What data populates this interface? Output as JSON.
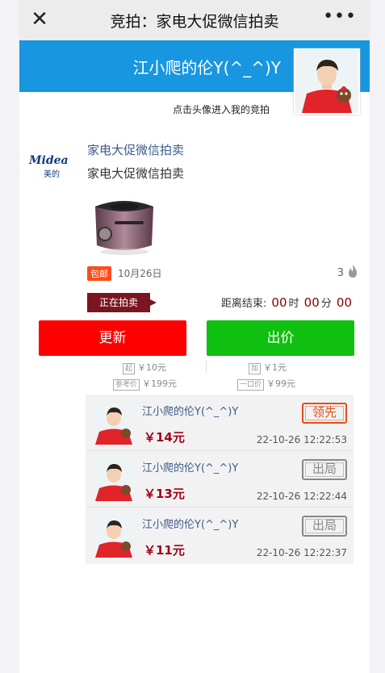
{
  "topbar": {
    "close_icon": "close-icon",
    "title": "竞拍：家电大促微信拍卖",
    "more_icon": "more-icon"
  },
  "banner": {
    "user_name": "江小爬的伦Y(^_^)Y",
    "hint": "点击头像进入我的竞拍",
    "color": "#1896e0"
  },
  "auction": {
    "brand_logo_en": "Midea",
    "brand_logo_cn": "美的",
    "seller": "家电大促微信拍卖",
    "item_title": "家电大促微信拍卖",
    "free_shipping_badge": "包邮",
    "date": "10月26日",
    "heat_count": "3",
    "status": "正在拍卖",
    "countdown_label": "距离结束:",
    "countdown": {
      "hours": "00",
      "hours_unit": "时",
      "minutes": "00",
      "minutes_unit": "分",
      "seconds": "00"
    }
  },
  "actions": {
    "refresh_label": "更新",
    "bid_label": "出价",
    "refresh_color": "#ff0000",
    "bid_color": "#10c010"
  },
  "rules": {
    "start_tag": "起",
    "start_value": "￥10元",
    "increment_tag": "加",
    "increment_value": "￥1元",
    "reference_tag": "参考价",
    "reference_value": "￥199元",
    "buyout_tag": "一口价",
    "buyout_value": "￥99元"
  },
  "bids": [
    {
      "name": "江小爬的伦Y(^_^)Y",
      "price": "￥14元",
      "time": "22-10-26 12:22:53",
      "stamp": "领先",
      "leading": true
    },
    {
      "name": "江小爬的伦Y(^_^)Y",
      "price": "￥13元",
      "time": "22-10-26 12:22:44",
      "stamp": "出局",
      "leading": false
    },
    {
      "name": "江小爬的伦Y(^_^)Y",
      "price": "￥11元",
      "time": "22-10-26 12:22:37",
      "stamp": "出局",
      "leading": false
    }
  ]
}
